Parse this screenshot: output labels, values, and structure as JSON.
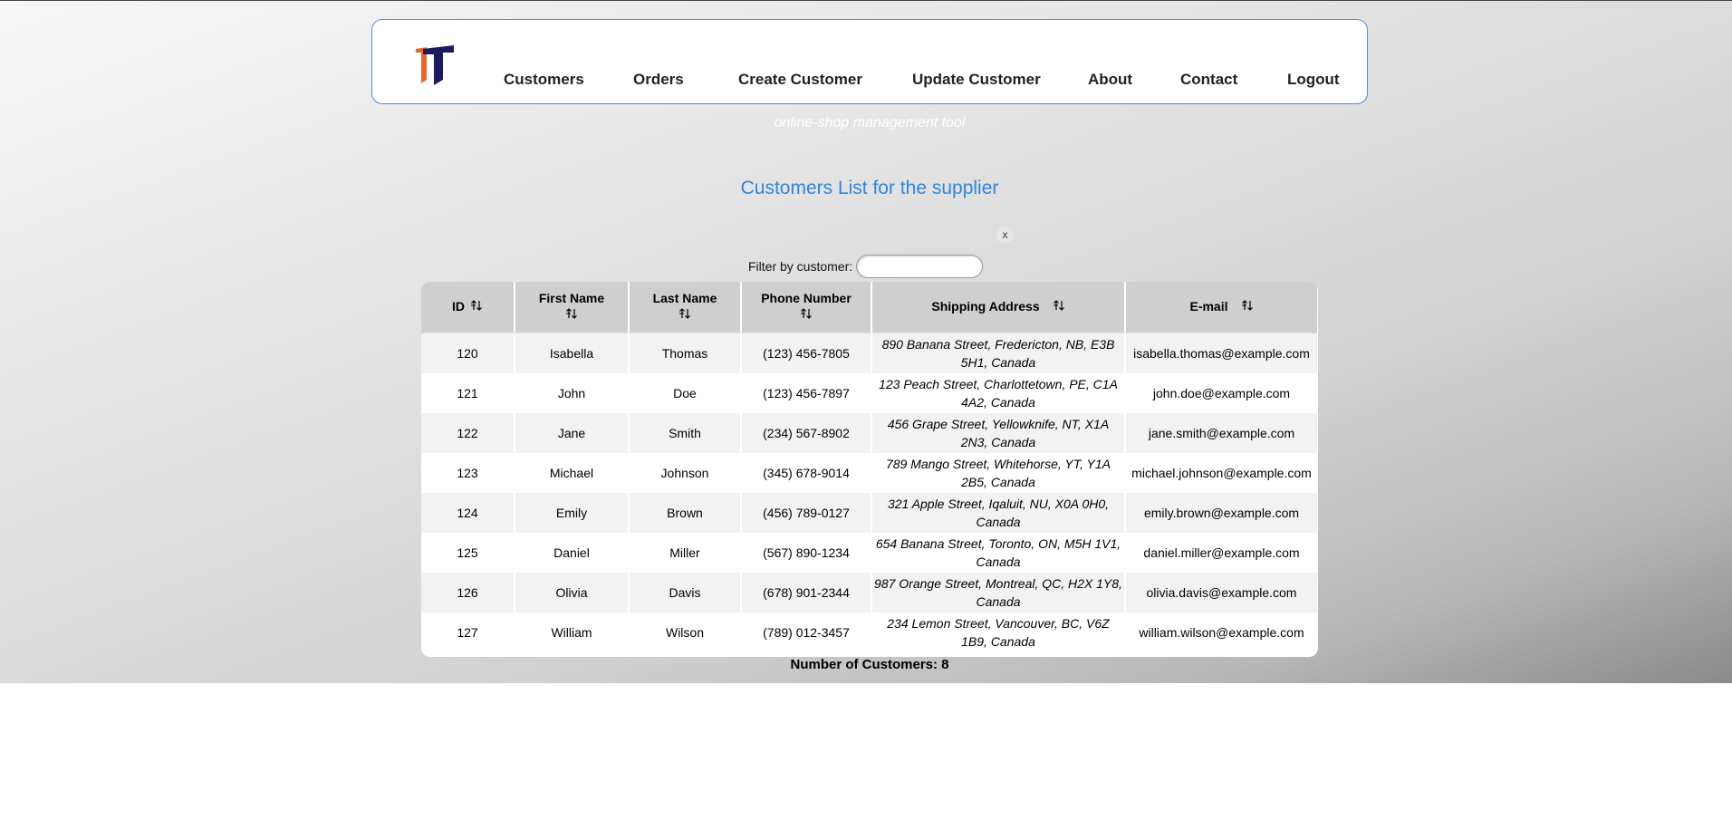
{
  "nav": {
    "items": [
      {
        "label": "Customers"
      },
      {
        "label": "Orders"
      },
      {
        "label": "Create Customer"
      },
      {
        "label": "Update Customer"
      },
      {
        "label": "About"
      },
      {
        "label": "Contact"
      },
      {
        "label": "Logout"
      }
    ]
  },
  "tagline": "online-shop management tool",
  "page_title": "Customers List for the supplier",
  "filter": {
    "label": "Filter by customer:",
    "value": "",
    "clear_label": "x"
  },
  "table": {
    "headers": [
      "ID",
      "First Name",
      "Last Name",
      "Phone Number",
      "Shipping Address",
      "E-mail"
    ],
    "rows": [
      [
        "120",
        "Isabella",
        "Thomas",
        "(123) 456-7805",
        "890 Banana Street, Fredericton, NB, E3B 5H1, Canada",
        "isabella.thomas@example.com"
      ],
      [
        "121",
        "John",
        "Doe",
        "(123) 456-7897",
        "123 Peach Street, Charlottetown, PE, C1A 4A2, Canada",
        "john.doe@example.com"
      ],
      [
        "122",
        "Jane",
        "Smith",
        "(234) 567-8902",
        "456 Grape Street, Yellowknife, NT, X1A 2N3, Canada",
        "jane.smith@example.com"
      ],
      [
        "123",
        "Michael",
        "Johnson",
        "(345) 678-9014",
        "789 Mango Street, Whitehorse, YT, Y1A 2B5, Canada",
        "michael.johnson@example.com"
      ],
      [
        "124",
        "Emily",
        "Brown",
        "(456) 789-0127",
        "321 Apple Street, Iqaluit, NU, X0A 0H0, Canada",
        "emily.brown@example.com"
      ],
      [
        "125",
        "Daniel",
        "Miller",
        "(567) 890-1234",
        "654 Banana Street, Toronto, ON, M5H 1V1, Canada",
        "daniel.miller@example.com"
      ],
      [
        "126",
        "Olivia",
        "Davis",
        "(678) 901-2344",
        "987 Orange Street, Montreal, QC, H2X 1Y8, Canada",
        "olivia.davis@example.com"
      ],
      [
        "127",
        "William",
        "Wilson",
        "(789) 012-3457",
        "234 Lemon Street, Vancouver, BC, V6Z 1B9, Canada",
        "william.wilson@example.com"
      ]
    ]
  },
  "count_text": "Number of Customers: 8",
  "colors": {
    "accent": "#2f86de",
    "logo_orange": "#e8652c",
    "logo_navy": "#1d1a5e"
  }
}
